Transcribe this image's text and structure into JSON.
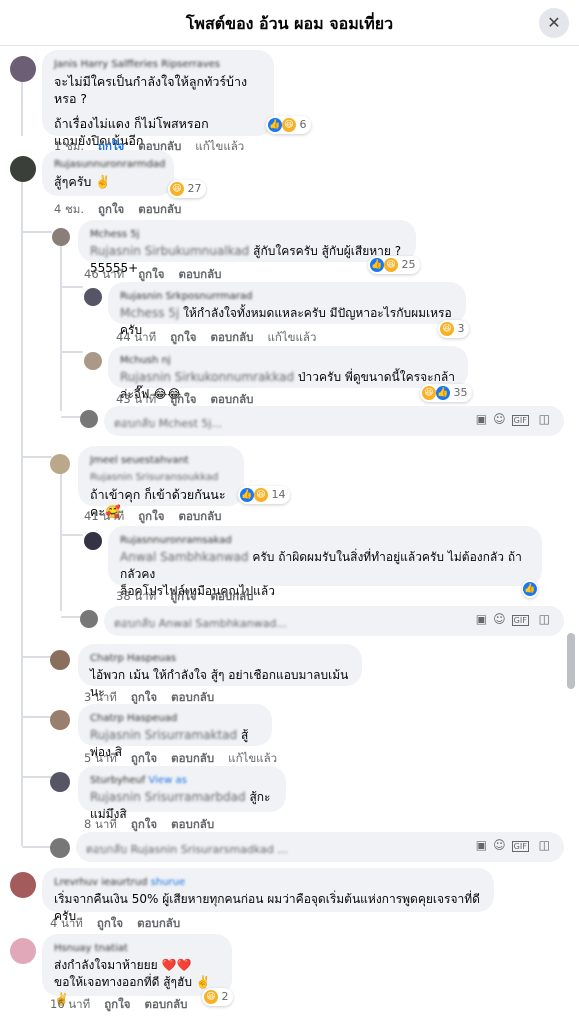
{
  "header": {
    "title": "โพสต์ของ อ้วน ผอม จอมเที่ยว",
    "close_icon": "close-icon"
  },
  "comments": [
    {
      "id": "c1",
      "name": "Janis Harry Salfferies Ripserraves",
      "lines": [
        "จะไม่มีใครเป็นกำลังใจให้ลูกทัวร์บ้างหรอ ?",
        "",
        "ถ้าเรื่องไม่แดง ก็ไม่โพสหรอก",
        "แถมยังปิดเม้นอีก"
      ],
      "reactions": "6",
      "time": "1 ชม.",
      "like": "ถูกใจ",
      "reply": "ตอบกลับ",
      "edit": "แก้ไขแล้ว"
    },
    {
      "id": "c2",
      "name": "Rujasunnuronrarmdad",
      "lines": [
        "สู้ๆครับ ✌️"
      ],
      "reactions": "27",
      "time": "4 ชม.",
      "like": "ถูกใจ",
      "reply": "ตอบกลับ"
    },
    {
      "id": "r1",
      "name": "Mchess 5j",
      "tag": "Rujasnin Sirbukumnualkad",
      "text": "สู้กับใครครับ สู้กับผู้เสียหาย ? 55555+",
      "reactions": "25",
      "time": "46 นาที",
      "like": "ถูกใจ",
      "reply": "ตอบกลับ"
    },
    {
      "id": "r2",
      "name": "Rujasnin Srkposnurrmarad",
      "tag": "Mchess 5j",
      "text": "ให้กำลังใจทั้งหมดแหละครับ มีปัญหาอะไรกับผมเหรอครับ",
      "reactions": "3",
      "time": "44 นาที",
      "like": "ถูกใจ",
      "reply": "ตอบกลับ",
      "edit": "แก้ไขแล้ว"
    },
    {
      "id": "r3",
      "name": "Mchush nj",
      "tag": "Rujasnin Sirkukonnumrakkad",
      "text": "ป่าวครับ พี่ดูขนาดนี้ใครจะกล้าล่ะจี๊ฟ 😂😂",
      "reactions": "35",
      "time": "43 นาที",
      "like": "ถูกใจ",
      "reply": "ตอบกลับ"
    },
    {
      "id": "c3",
      "name": "Jmeel seuestahvant",
      "tag": "Rujasnin Srisuransoukkad",
      "text": "ถ้าเข้าคุก ก็เข้าด้วยกันนะคะ🥰",
      "reactions": "14",
      "time": "41 นาที",
      "like": "ถูกใจ",
      "reply": "ตอบกลับ"
    },
    {
      "id": "r4",
      "name": "Rujasnnuronramsakad",
      "tag": "Anwal Sambhkanwad",
      "text1": "ครับ ถ้าผิดผมรับในสิ่งที่ทำอยู่แล้วครับ ไม่ต้องกลัว ถ้ากลัวคง",
      "text2": "ล็อคโปรไฟล์เหมือนคุณไปแล้ว",
      "time": "38 นาที",
      "like": "ถูกใจ",
      "reply": "ตอบกลับ"
    },
    {
      "id": "c4",
      "name": "Chatrp Haspeuas",
      "text": "ไอ้พวก เม้น ให้กำลังใจ สู้ๆ อย่าเชือกแอบมาลบเม้น นะ",
      "time": "3 นาที",
      "like": "ถูกใจ",
      "reply": "ตอบกลับ"
    },
    {
      "id": "c5",
      "name": "Chatrp Haspeuad",
      "tag": "Rujasnin Srisurramaktad",
      "text": "สู้ พ่อง สิ",
      "time": "5 นาที",
      "like": "ถูกใจ",
      "reply": "ตอบกลับ",
      "edit": "แก้ไขแล้ว"
    },
    {
      "id": "c6",
      "name": "Sturbyheuf",
      "view": "View as",
      "tag": "Rujasnin Srisurramarbdad",
      "text": "สู้กะแม่มึงสิ",
      "time": "8 นาที",
      "like": "ถูกใจ",
      "reply": "ตอบกลับ"
    },
    {
      "id": "c7",
      "name": "Lrevrhuv ieaurtrud",
      "view": "shurue",
      "text": "เริ่มจากคืนเงิน 50% ผู้เสียหายทุกคนก่อน ผมว่าคือจุดเริ่มต้นแห่งการพูดคุยเจรจาที่ดีครับ",
      "time": "4 นาที",
      "like": "ถูกใจ",
      "reply": "ตอบกลับ"
    },
    {
      "id": "c8",
      "name": "Hsnuay tnatiat",
      "lines": [
        "ส่งกำลังใจมาห้ายยย ❤️❤️",
        "ขอให้เจอทางออกที่ดี สู้ๆฮับ ✌️✌️"
      ],
      "reactions": "2",
      "time": "16 นาที",
      "like": "ถูกใจ",
      "reply": "ตอบกลับ"
    }
  ],
  "inputs": [
    {
      "placeholder": "ตอบกลับ Mchest 5j..."
    },
    {
      "placeholder": "ตอบกลับ Anwal Sambhkanwad..."
    },
    {
      "placeholder": "ตอบกลับ Rujasnin Srisurarsmadkad ..."
    }
  ],
  "tool_icons": [
    "sticker-comment-icon",
    "emoji-icon",
    "gif-icon",
    "sticker-icon"
  ],
  "colors": {
    "accent": "#1b74e4",
    "bubble": "#f0f2f5",
    "muted": "#65676b"
  }
}
